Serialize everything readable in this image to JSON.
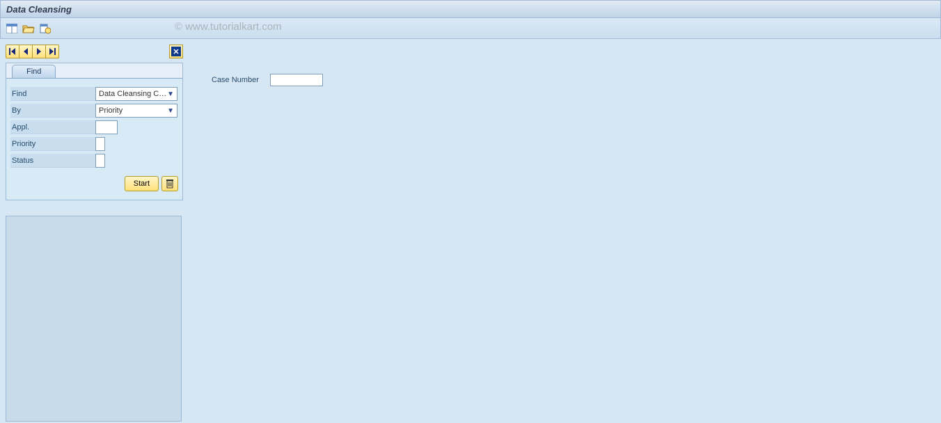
{
  "title": "Data Cleansing",
  "watermark": "© www.tutorialkart.com",
  "toolbar_icons": {
    "layout": "layout-icon",
    "folder": "folder-open-icon",
    "tool": "tool-icon"
  },
  "sidebar": {
    "tab_label": "Find",
    "find_label": "Find",
    "find_value": "Data Cleansing C…",
    "by_label": "By",
    "by_value": "Priority",
    "appl_label": "Appl.",
    "appl_value": "",
    "priority_label": "Priority",
    "priority_value": "",
    "status_label": "Status",
    "status_value": "",
    "start_label": "Start"
  },
  "main": {
    "case_number_label": "Case Number",
    "case_number_value": ""
  }
}
